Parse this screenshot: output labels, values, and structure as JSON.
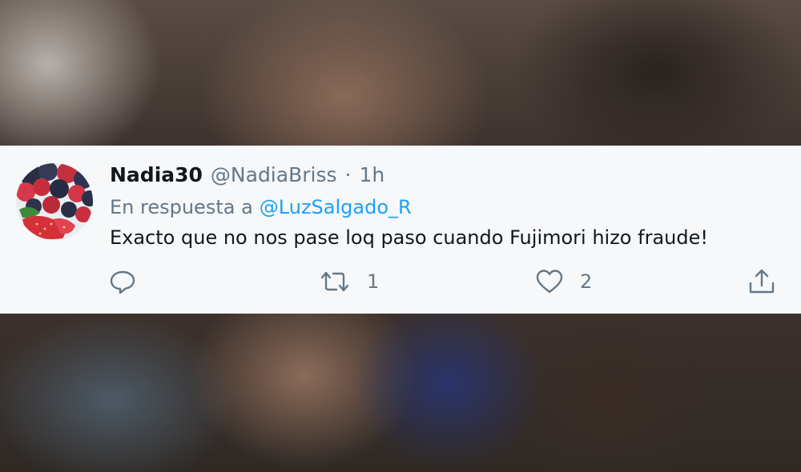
{
  "tweet": {
    "avatar_icon": "berries-avatar-icon",
    "display_name": "Nadia30",
    "handle": "@NadiaBriss",
    "separator": "·",
    "time": "1h",
    "reply_prefix": "En respuesta a",
    "reply_to": "@LuzSalgado_R",
    "text": "Exacto que no nos pase loq paso cuando Fujimori hizo fraude!",
    "actions": {
      "reply": {
        "icon": "reply-icon"
      },
      "retweet": {
        "icon": "retweet-icon",
        "count": "1"
      },
      "like": {
        "icon": "heart-icon",
        "count": "2"
      },
      "share": {
        "icon": "share-icon"
      }
    }
  },
  "colors": {
    "card_background": "#f6f8fa",
    "primary_text": "#14171a",
    "secondary_text": "#657786",
    "link": "#1da1f2"
  }
}
